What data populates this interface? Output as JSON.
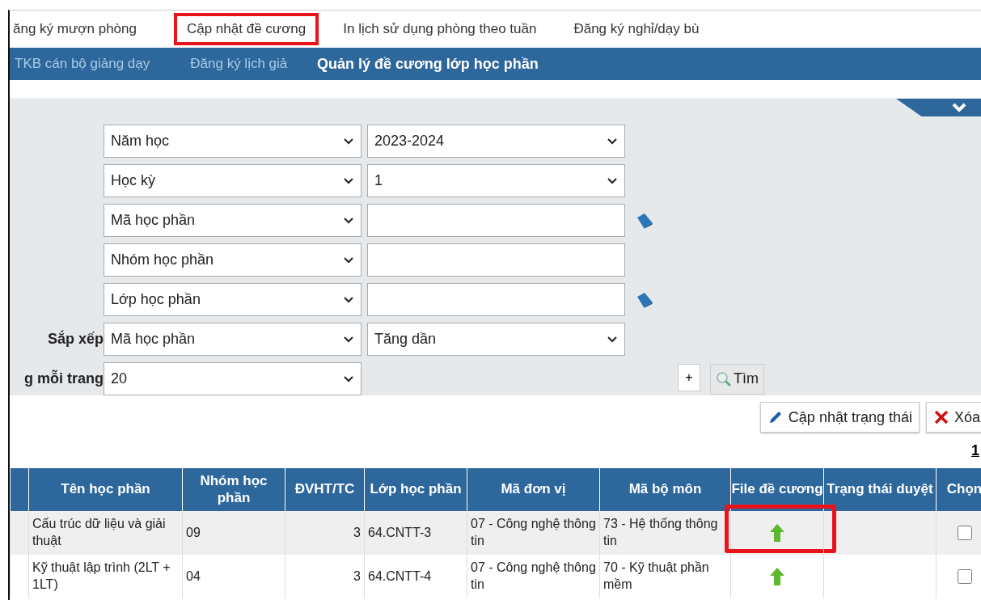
{
  "menu": [
    {
      "label": "ăng ký mượn phòng",
      "highlighted": false
    },
    {
      "label": "Cập nhật đề cương",
      "highlighted": true
    },
    {
      "label": "In lịch sử dụng phòng theo tuần",
      "highlighted": false
    },
    {
      "label": "Đăng ký nghỉ/dạy bù",
      "highlighted": false
    }
  ],
  "submenu_overflow": [
    "TKB cán bộ giảng dạy",
    "Đăng ký lịch giả"
  ],
  "page_title": "Quản lý đề cương lớp học phần",
  "filters": [
    {
      "lookup": false,
      "fields": [
        {
          "kind": "select",
          "value": "Năm học"
        },
        {
          "kind": "select",
          "value": "2023-2024"
        }
      ]
    },
    {
      "lookup": false,
      "fields": [
        {
          "kind": "select",
          "value": "Học kỳ"
        },
        {
          "kind": "select",
          "value": "1"
        }
      ]
    },
    {
      "lookup": true,
      "fields": [
        {
          "kind": "select",
          "value": "Mã học phần"
        },
        {
          "kind": "input"
        }
      ]
    },
    {
      "lookup": false,
      "fields": [
        {
          "kind": "select",
          "value": "Nhóm học phần"
        },
        {
          "kind": "input"
        }
      ]
    },
    {
      "lookup": true,
      "fields": [
        {
          "kind": "select",
          "value": "Lớp học phần"
        },
        {
          "kind": "input"
        }
      ]
    },
    {
      "label": "Sắp xếp",
      "lookup": false,
      "fields": [
        {
          "kind": "select",
          "value": "Mã học phần"
        },
        {
          "kind": "select",
          "value": "Tăng dần"
        }
      ]
    },
    {
      "label": "g mỗi trang",
      "lookup": false,
      "fields": [
        {
          "kind": "select",
          "value": "20"
        }
      ]
    }
  ],
  "add_button": "+",
  "search_button": "Tìm",
  "actions": [
    {
      "kind": "edit",
      "label": "Cập nhật trạng thái"
    },
    {
      "kind": "delete",
      "label": "Xóa"
    }
  ],
  "pager": "1",
  "table": {
    "columns": [
      "Tên học phần",
      "Nhóm học phần",
      "ĐVHT/TC",
      "Lớp học phần",
      "Mã đơn vị",
      "Mã bộ môn",
      "File đề cương",
      "Trạng thái duyệt",
      "Chọn"
    ],
    "rows": [
      {
        "name": "Cấu trúc dữ liệu và giải thuật",
        "group": "09",
        "credits": "3",
        "class": "64.CNTT-3",
        "unit": "07 - Công nghệ thông tin",
        "dept": "73 - Hệ thống thông tin",
        "has_file": true,
        "file_highlighted": true,
        "selected": false
      },
      {
        "name": "Kỹ thuật lập trình (2LT + 1LT)",
        "group": "04",
        "credits": "3",
        "class": "64.CNTT-4",
        "unit": "07 - Công nghệ thông tin",
        "dept": "70 - Kỹ thuật phần mềm",
        "has_file": true,
        "file_highlighted": false,
        "selected": false
      }
    ]
  }
}
